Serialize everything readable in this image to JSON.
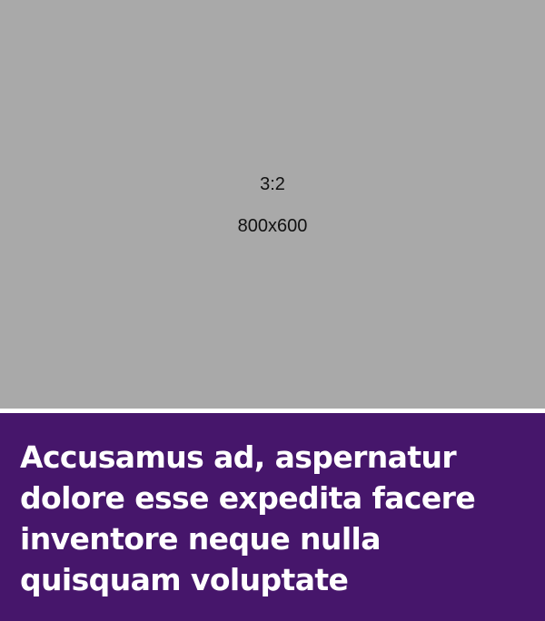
{
  "placeholder": {
    "ratio_label": "3:2",
    "size_label": "800x600"
  },
  "caption": {
    "text": "Accusamus ad, aspernatur dolore esse expedita facere inventore neque nulla quisquam voluptate"
  },
  "colors": {
    "placeholder_bg": "#a9a9a9",
    "caption_bg": "#46166b",
    "caption_text": "#ffffff"
  }
}
